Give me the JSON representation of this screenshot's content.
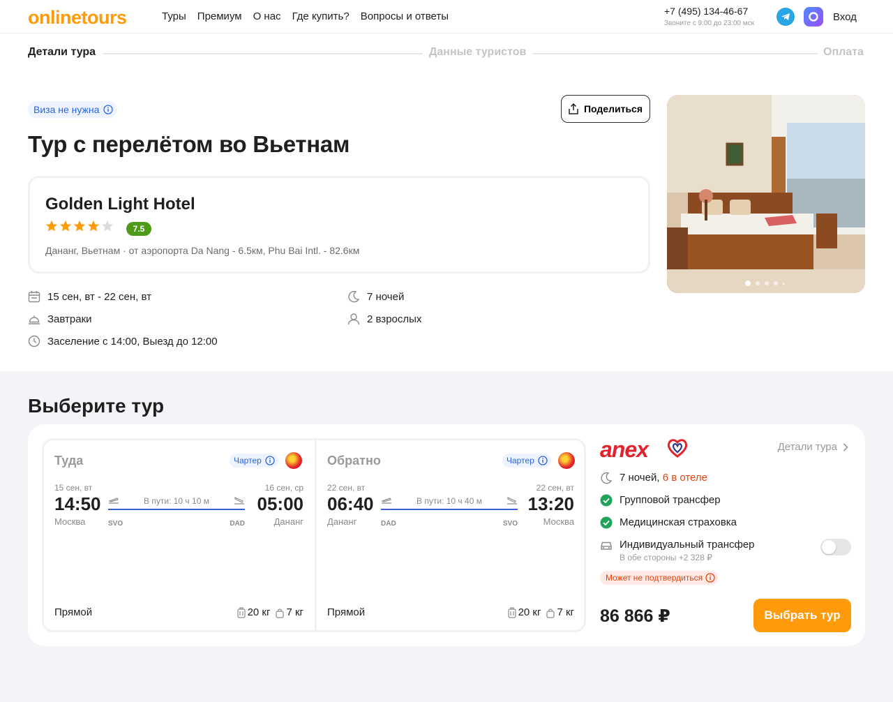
{
  "header": {
    "logo": "onlinetours",
    "nav": [
      "Туры",
      "Премиум",
      "О нас",
      "Где купить?",
      "Вопросы и ответы"
    ],
    "phone": "+7 (495) 134-46-67",
    "phone_hours": "Звоните с 9:00 до 23:00 мск",
    "login": "Вход"
  },
  "steps": [
    "Детали тура",
    "Данные туристов",
    "Оплата"
  ],
  "visa_badge": "Виза не нужна",
  "share_label": "Поделиться",
  "title": "Тур с перелётом во Вьетнам",
  "hotel": {
    "name": "Golden Light Hotel",
    "stars": 4,
    "stars_max": 5,
    "rating": "7.5",
    "location": "Дананг, Вьетнам · от аэропорта Da Nang - 6.5км, Phu Bai Intl. - 82.6км"
  },
  "facts": {
    "dates": "15 сен, вт - 22 сен, вт",
    "nights": "7 ночей",
    "meal": "Завтраки",
    "guests": "2 взрослых",
    "checkin": "Заселение с 14:00, Выезд до 12:00"
  },
  "gallery": {
    "slides": 5,
    "active": 0
  },
  "choose_title": "Выберите тур",
  "flights": [
    {
      "title": "Туда",
      "charter": "Чартер",
      "dep_date": "15 сен, вт",
      "dep_time": "14:50",
      "dep_city": "Москва",
      "dep_code": "SVO",
      "duration": "В пути: 10 ч 10 м",
      "arr_date": "16 сен, ср",
      "arr_time": "05:00",
      "arr_city": "Дананг",
      "arr_code": "DAD",
      "type": "Прямой",
      "baggage": "20 кг",
      "hand": "7 кг"
    },
    {
      "title": "Обратно",
      "charter": "Чартер",
      "dep_date": "22 сен, вт",
      "dep_time": "06:40",
      "dep_city": "Дананг",
      "dep_code": "DAD",
      "duration": "В пути: 10 ч 40 м",
      "arr_date": "22 сен, вт",
      "arr_time": "13:20",
      "arr_city": "Москва",
      "arr_code": "SVO",
      "type": "Прямой",
      "baggage": "20 кг",
      "hand": "7 кг"
    }
  ],
  "offer": {
    "operator": "anex",
    "details_link": "Детали тура",
    "nights": "7 ночей,",
    "in_hotel": "6 в отеле",
    "group_transfer": "Групповой трансфер",
    "insurance": "Медицинская страховка",
    "individual_transfer": "Индивидуальный трансфер",
    "individual_transfer_sub": "В обе стороны +2 328 ₽",
    "individual_transfer_enabled": false,
    "warning": "Может не подтвердиться",
    "price": "86 866 ₽",
    "select_button": "Выбрать тур"
  },
  "colors": {
    "brand": "#ff9a0a",
    "accent_blue": "#2a64e0",
    "route": "#3d5bd9",
    "rating": "#4f9a1a",
    "warn": "#e8420c",
    "operator": "#e2232b"
  }
}
